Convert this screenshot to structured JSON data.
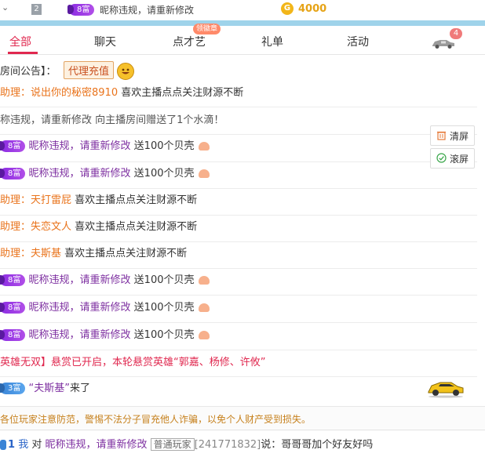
{
  "top": {
    "rank": "2",
    "badge": "8富",
    "nickname": "昵称违规，请重新修改",
    "coin_glyph": "G",
    "coins": "4000"
  },
  "tabs": [
    {
      "label": "全部",
      "active": true
    },
    {
      "label": "聊天"
    },
    {
      "label": "点才艺"
    },
    {
      "label": "礼单"
    },
    {
      "label": "活动"
    }
  ],
  "tab_tag": "领徽章",
  "car_count": "4",
  "notice": {
    "label": "房间公告】：",
    "agent": "代理充值"
  },
  "side": {
    "clear": "清屏",
    "scroll": "滚屏"
  },
  "messages": [
    {
      "type": "assistant",
      "prefix": "助理：",
      "who": "说出你的秘密8910",
      "text": "喜欢主播点点关注财源不断"
    },
    {
      "type": "plain",
      "text": "称违规，请重新修改 向主播房间赠送了1个水滴！"
    },
    {
      "type": "gift",
      "badge": "8富",
      "who": "昵称违规，请重新修改",
      "text": "送100个贝壳"
    },
    {
      "type": "gift",
      "badge": "8富",
      "who": "昵称违规，请重新修改",
      "text": "送100个贝壳"
    },
    {
      "type": "assistant",
      "prefix": "助理：",
      "who": "天打雷屁",
      "text": "喜欢主播点点关注财源不断"
    },
    {
      "type": "assistant",
      "prefix": "助理：",
      "who": "失恋文人",
      "text": "喜欢主播点点关注财源不断"
    },
    {
      "type": "assistant",
      "prefix": "助理：",
      "who": "夫斯基",
      "text": "喜欢主播点点关注财源不断"
    },
    {
      "type": "gift",
      "badge": "8富",
      "who": "昵称违规，请重新修改",
      "text": "送100个贝壳"
    },
    {
      "type": "gift",
      "badge": "8富",
      "who": "昵称违规，请重新修改",
      "text": "送100个贝壳"
    },
    {
      "type": "gift",
      "badge": "8富",
      "who": "昵称违规，请重新修改",
      "text": "送100个贝壳"
    },
    {
      "type": "hero",
      "text": "英雄无双】悬赏已开启，本轮悬赏英雄“郭嘉、杨修、许攸”"
    },
    {
      "type": "enter",
      "badge": "3富",
      "who": "“夫斯基”",
      "text": "来了"
    }
  ],
  "warning": "各位玩家注意防范，警惕不法分子冒充他人诈骗，以免个人财产受到损失。",
  "chat_input": {
    "level": "1",
    "me": "我",
    "to": "对",
    "target": "昵称违规，请重新修改",
    "role": "普通玩家",
    "id": "[241771832]",
    "said": "说：",
    "content": "哥哥哥加个好友好吗"
  }
}
